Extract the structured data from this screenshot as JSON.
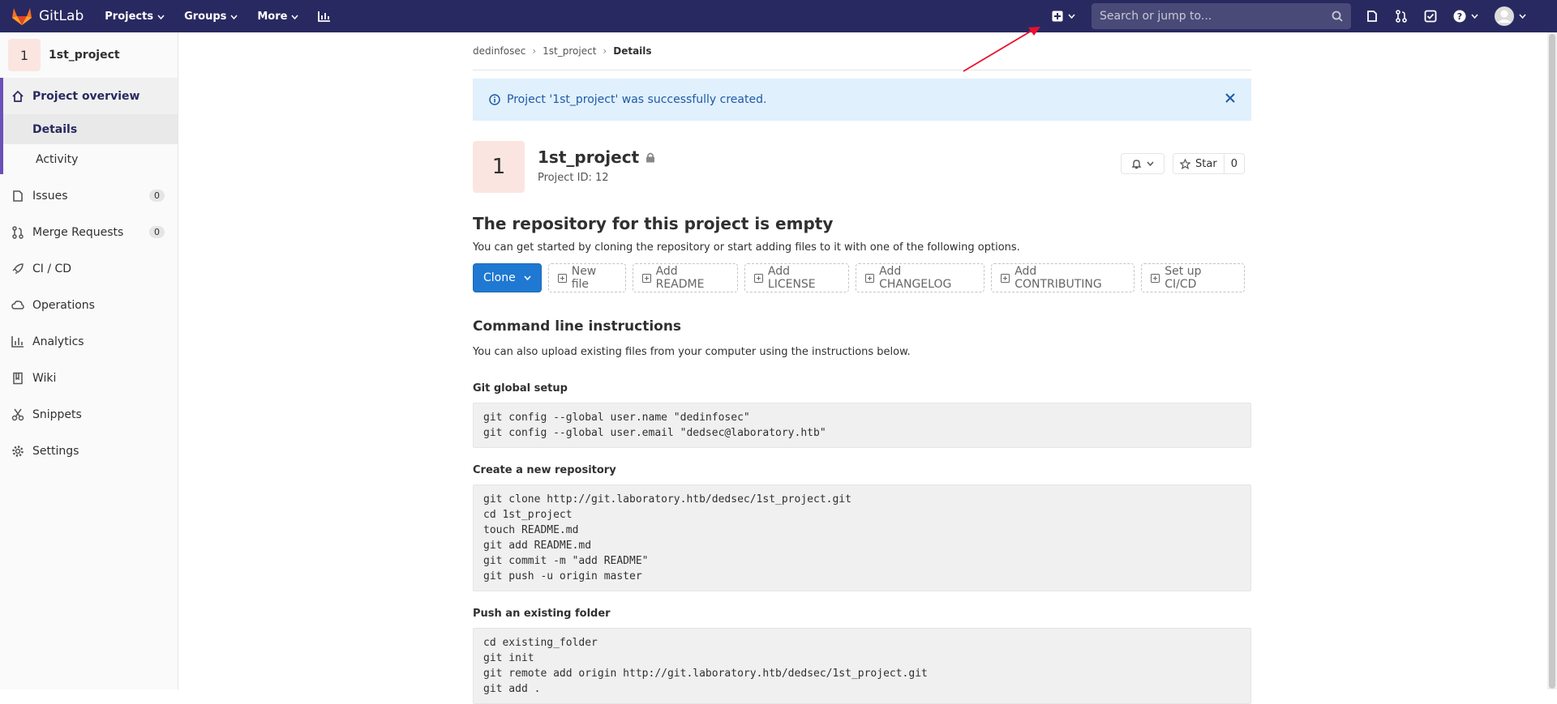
{
  "topbar": {
    "brand": "GitLab",
    "nav": [
      "Projects",
      "Groups",
      "More"
    ],
    "search_placeholder": "Search or jump to..."
  },
  "sidebar": {
    "project_initial": "1",
    "project_name": "1st_project",
    "overview": "Project overview",
    "sub": [
      "Details",
      "Activity"
    ],
    "items": [
      {
        "label": "Issues",
        "count": "0"
      },
      {
        "label": "Merge Requests",
        "count": "0"
      },
      {
        "label": "CI / CD"
      },
      {
        "label": "Operations"
      },
      {
        "label": "Analytics"
      },
      {
        "label": "Wiki"
      },
      {
        "label": "Snippets"
      },
      {
        "label": "Settings"
      }
    ]
  },
  "breadcrumb": [
    "dedinfosec",
    "1st_project",
    "Details"
  ],
  "alert": "Project '1st_project' was successfully created.",
  "project": {
    "initial": "1",
    "name": "1st_project",
    "id_text": "Project ID: 12",
    "star_label": "Star",
    "star_count": "0"
  },
  "empty": {
    "title": "The repository for this project is empty",
    "desc": "You can get started by cloning the repository or start adding files to it with one of the following options.",
    "clone": "Clone",
    "buttons": [
      "New file",
      "Add README",
      "Add LICENSE",
      "Add CHANGELOG",
      "Add CONTRIBUTING",
      "Set up CI/CD"
    ]
  },
  "cli": {
    "title": "Command line instructions",
    "desc": "You can also upload existing files from your computer using the instructions below.",
    "git_global_title": "Git global setup",
    "git_global_code": "git config --global user.name \"dedinfosec\"\ngit config --global user.email \"dedsec@laboratory.htb\"",
    "new_repo_title": "Create a new repository",
    "new_repo_code": "git clone http://git.laboratory.htb/dedsec/1st_project.git\ncd 1st_project\ntouch README.md\ngit add README.md\ngit commit -m \"add README\"\ngit push -u origin master",
    "push_folder_title": "Push an existing folder",
    "push_folder_code": "cd existing_folder\ngit init\ngit remote add origin http://git.laboratory.htb/dedsec/1st_project.git\ngit add ."
  },
  "colors": {
    "topbar": "#292961",
    "accent": "#6b4fbb",
    "clone": "#1f78d1",
    "alert_bg": "#e0f0fc",
    "arrow": "#e8112d"
  }
}
